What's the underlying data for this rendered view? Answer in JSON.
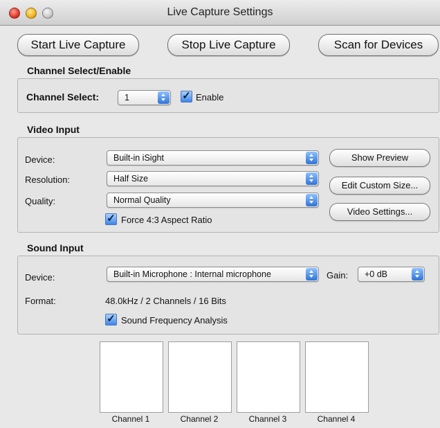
{
  "window": {
    "title": "Live Capture Settings"
  },
  "toolbar": {
    "start_label": "Start Live Capture",
    "stop_label": "Stop Live Capture",
    "scan_label": "Scan for Devices"
  },
  "channel_section": {
    "title": "Channel Select/Enable",
    "channel_label": "Channel Select:",
    "channel_value": "1",
    "enable_label": "Enable",
    "enable_checked": true
  },
  "video_section": {
    "title": "Video Input",
    "device_label": "Device:",
    "device_value": "Built-in iSight",
    "resolution_label": "Resolution:",
    "resolution_value": "Half Size",
    "quality_label": "Quality:",
    "quality_value": "Normal Quality",
    "aspect_label": "Force 4:3 Aspect Ratio",
    "aspect_checked": true,
    "show_preview_label": "Show Preview",
    "edit_custom_label": "Edit Custom Size...",
    "video_settings_label": "Video Settings..."
  },
  "sound_section": {
    "title": "Sound Input",
    "device_label": "Device:",
    "device_value": "Built-in Microphone : Internal microphone",
    "gain_label": "Gain:",
    "gain_value": "+0 dB",
    "format_label": "Format:",
    "format_value": "48.0kHz / 2 Channels / 16 Bits",
    "analysis_label": "Sound Frequency Analysis",
    "analysis_checked": true
  },
  "channels": [
    {
      "label": "Channel 1"
    },
    {
      "label": "Channel 2"
    },
    {
      "label": "Channel 3"
    },
    {
      "label": "Channel 4"
    }
  ],
  "colors": {
    "window_bg": "#e8e8e8",
    "accent_blue": "#3d86e8",
    "close_red": "#e0392c",
    "minimize_yellow": "#f2b31c"
  }
}
